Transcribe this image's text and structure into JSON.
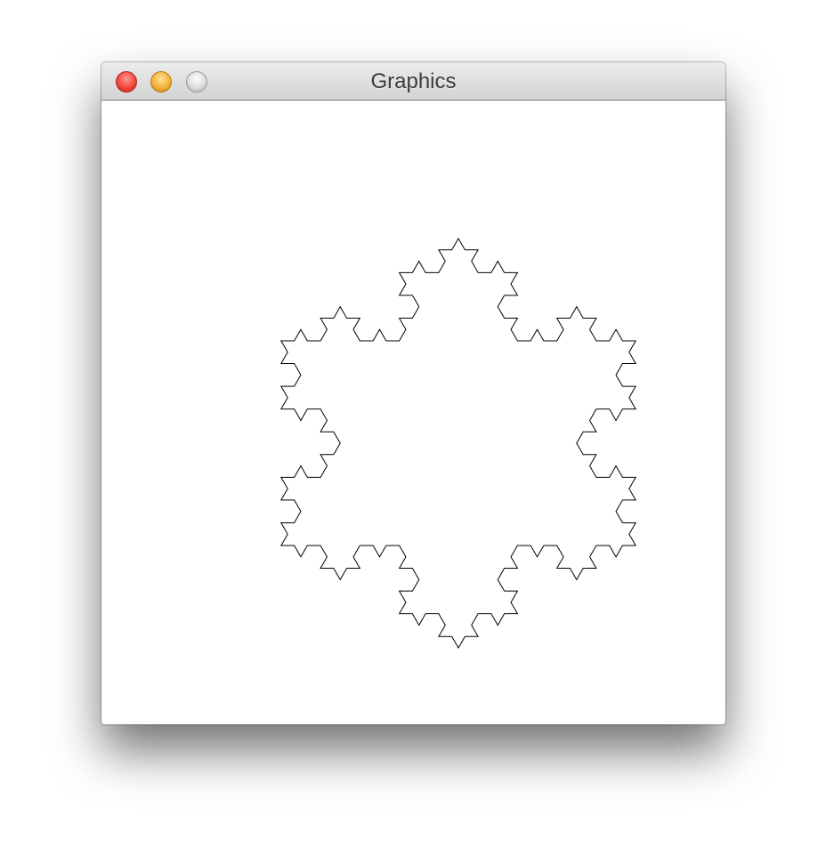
{
  "window": {
    "title": "Graphics"
  },
  "graphics": {
    "shape": "koch-snowflake",
    "iterations": 3,
    "stroke_color": "#000000",
    "background_color": "#ffffff"
  }
}
